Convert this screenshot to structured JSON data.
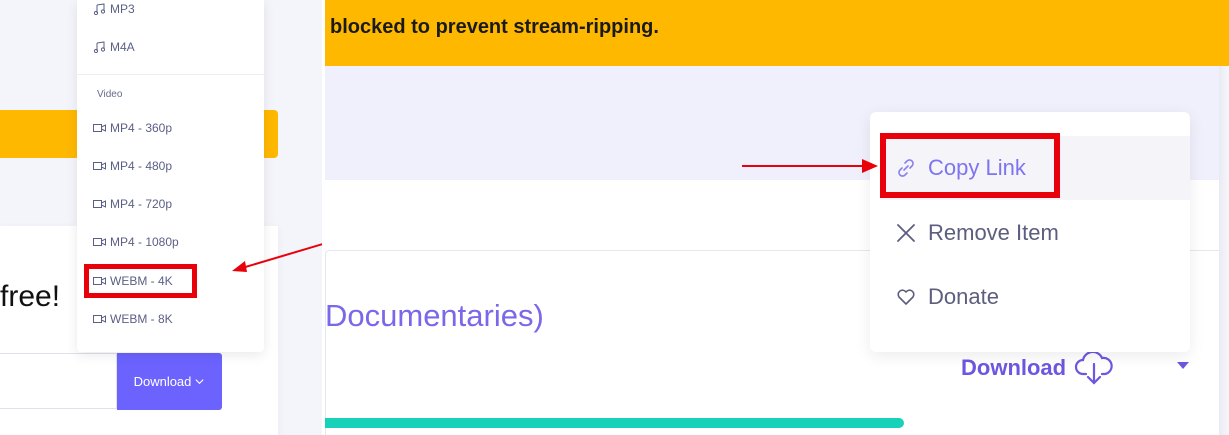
{
  "left": {
    "free_text": "free!",
    "download_button": "Download",
    "format_menu": {
      "audio_items": [
        "MP3",
        "M4A"
      ],
      "video_label": "Video",
      "video_items": [
        "MP4 - 360p",
        "MP4 - 480p",
        "MP4 - 720p",
        "MP4 - 1080p",
        "WEBM - 4K",
        "WEBM - 8K"
      ]
    }
  },
  "right": {
    "banner_text": "blocked to prevent stream-ripping.",
    "video_title": "Documentaries)",
    "download_label": "Download",
    "context_menu": {
      "copy_link": "Copy Link",
      "remove_item": "Remove Item",
      "donate": "Donate"
    }
  },
  "colors": {
    "accent": "#6c63ff",
    "banner": "#ffb800",
    "highlight_red": "#e8000b",
    "progress": "#17d2b8"
  },
  "progress_fraction": 0.64
}
